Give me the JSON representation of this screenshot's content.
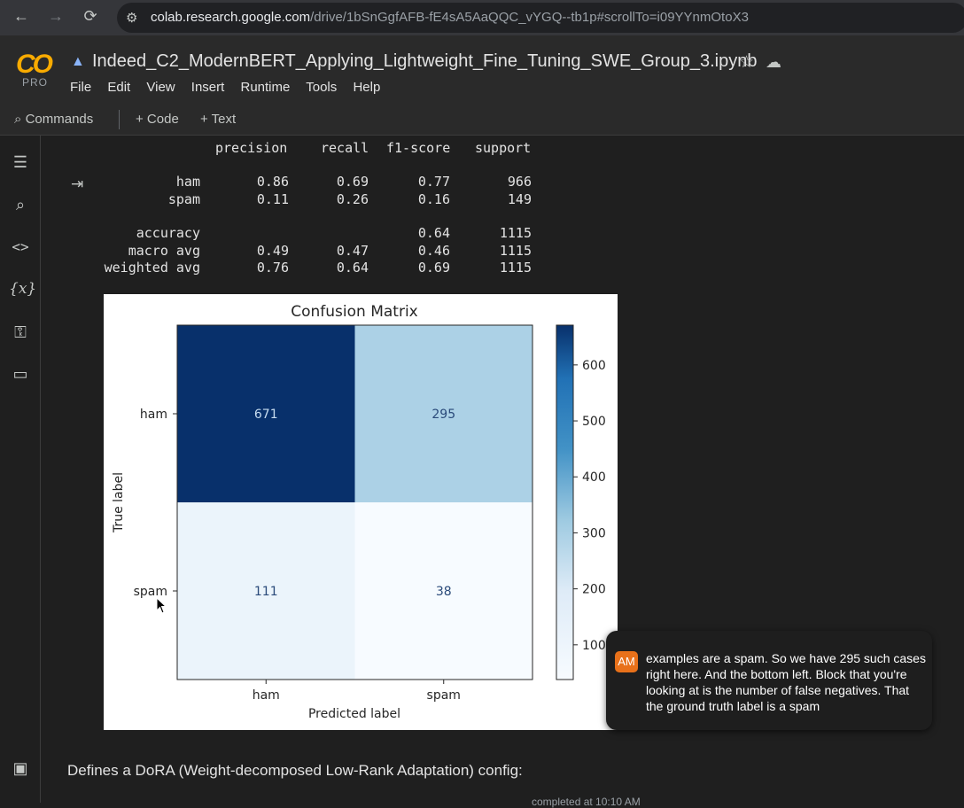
{
  "browser": {
    "back_icon": "←",
    "forward_icon": "→",
    "reload_icon": "⟳",
    "url_host": "colab.research.google.com",
    "url_path": "/drive/1bSnGgfAFB-fE4sA5AaQQC_vYGQ--tb1p#scrollTo=i09YYnmOtoX3"
  },
  "header": {
    "logo": "CO",
    "plan": "PRO",
    "notebook_title": "Indeed_C2_ModernBERT_Applying_Lightweight_Fine_Tuning_SWE_Group_3.ipynb",
    "menu": [
      "File",
      "Edit",
      "View",
      "Insert",
      "Runtime",
      "Tools",
      "Help"
    ]
  },
  "toolbar": {
    "commands_label": "Commands",
    "add_code_label": "+ Code",
    "add_text_label": "+ Text"
  },
  "report": {
    "headers": [
      "precision",
      "recall",
      "f1-score",
      "support"
    ],
    "rows": [
      {
        "label": "ham",
        "precision": "0.86",
        "recall": "0.69",
        "f1": "0.77",
        "support": "966"
      },
      {
        "label": "spam",
        "precision": "0.11",
        "recall": "0.26",
        "f1": "0.16",
        "support": "149"
      },
      {
        "label": "accuracy",
        "precision": "",
        "recall": "",
        "f1": "0.64",
        "support": "1115"
      },
      {
        "label": "macro avg",
        "precision": "0.49",
        "recall": "0.47",
        "f1": "0.46",
        "support": "1115"
      },
      {
        "label": "weighted avg",
        "precision": "0.76",
        "recall": "0.64",
        "f1": "0.69",
        "support": "1115"
      }
    ]
  },
  "chart_data": {
    "type": "heatmap",
    "title": "Confusion Matrix",
    "xlabel": "Predicted label",
    "ylabel": "True label",
    "x_categories": [
      "ham",
      "spam"
    ],
    "y_categories": [
      "ham",
      "spam"
    ],
    "values": [
      [
        671,
        295
      ],
      [
        111,
        38
      ]
    ],
    "colormap": "Blues",
    "colorbar_ticks": [
      100,
      200,
      300,
      400,
      500,
      600
    ],
    "colorbar_range": [
      38,
      671
    ]
  },
  "text_cell": "Defines a DoRA (Weight-decomposed Low-Rank Adaptation) config:",
  "caption": {
    "initials": "AM",
    "text": "examples are a spam. So we have 295 such cases right here. And the bottom left. Block that you're looking at is the number of false negatives. That the ground truth label is a spam"
  },
  "status": "completed at 10:10 AM"
}
